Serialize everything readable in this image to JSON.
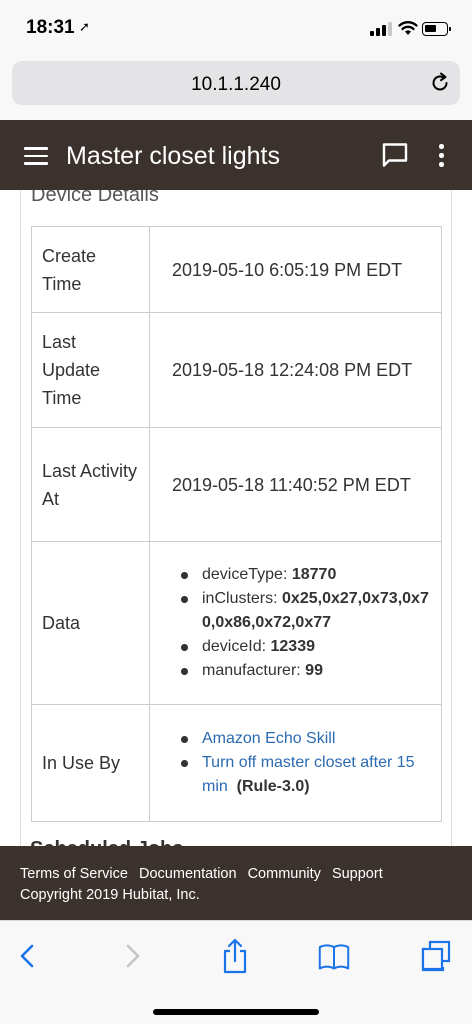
{
  "status_bar": {
    "time": "18:31",
    "location_arrow": "➚",
    "battery_level": 0.55
  },
  "browser": {
    "url": "10.1.1.240"
  },
  "header": {
    "title": "Master closet lights"
  },
  "section": {
    "title": "Device Details"
  },
  "details": {
    "create_time": {
      "label": "Create Time",
      "value": "2019-05-10 6:05:19 PM EDT"
    },
    "last_update": {
      "label": "Last Update Time",
      "value": "2019-05-18 12:24:08 PM EDT"
    },
    "last_activity": {
      "label": "Last Activity At",
      "value": "2019-05-18 11:40:52 PM EDT"
    },
    "data": {
      "label": "Data",
      "items": [
        {
          "key": "deviceType:",
          "value": "18770"
        },
        {
          "key": "inClusters:",
          "value": "0x25,0x27,0x73,0x70,0x86,0x72,0x77"
        },
        {
          "key": "deviceId:",
          "value": "12339"
        },
        {
          "key": "manufacturer:",
          "value": "99"
        }
      ]
    },
    "in_use_by": {
      "label": "In Use By",
      "items": [
        {
          "link": "Amazon Echo Skill",
          "suffix": ""
        },
        {
          "link": "Turn off master closet after 15 min",
          "suffix": "(Rule-3.0)"
        }
      ]
    }
  },
  "next_section_partial": "Scheduled Jobs",
  "footer": {
    "links": [
      "Terms of Service",
      "Documentation",
      "Community",
      "Support"
    ],
    "copyright": "Copyright 2019 Hubitat, Inc."
  },
  "colors": {
    "header_bg": "#3b312d",
    "link": "#2a6ab0",
    "ios_blue": "#1a73e8"
  },
  "icons": [
    "location-arrow-icon",
    "signal-icon",
    "wifi-icon",
    "battery-icon",
    "reload-icon",
    "menu-icon",
    "chat-icon",
    "more-vert-icon",
    "back-icon",
    "forward-icon",
    "share-icon",
    "bookmarks-icon",
    "tabs-icon"
  ]
}
